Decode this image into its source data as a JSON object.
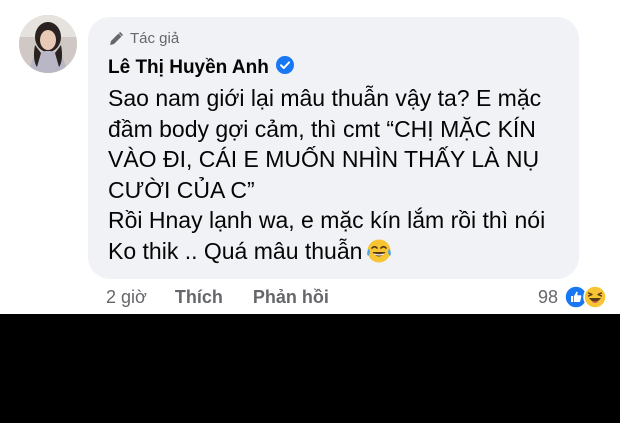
{
  "comment": {
    "author_badge": "Tác giả",
    "author_name": "Lê Thị Huyền Anh",
    "verified": true,
    "text": "Sao nam giới lại mâu thuẫn vậy ta? E mặc\nđầm body gợi cảm, thì cmt “CHỊ MẶC KÍN\nVÀO ĐI, CÁI E MUỐN NHÌN THẤY LÀ NỤ\nCƯỜI CỦA C”\nRồi Hnay lạnh wa, e mặc kín lắm rồi thì nói\nKo thik .. Quá mâu thuẫn",
    "trailing_emoji": "tears-of-joy-emoji",
    "time": "2 giờ",
    "like_label": "Thích",
    "reply_label": "Phản hồi",
    "reaction_count": "98",
    "reaction_icons": [
      "like-icon",
      "haha-icon"
    ]
  },
  "colors": {
    "bubble": "#f0f2f5",
    "secondary_text": "#65676b",
    "primary_text": "#050505",
    "verified_blue": "#1877f2",
    "bottom_band": "#000000"
  }
}
